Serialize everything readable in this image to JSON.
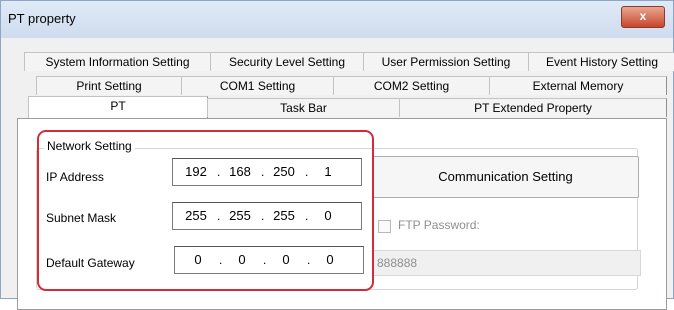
{
  "window": {
    "title": "PT property",
    "close_label": "x"
  },
  "tabs": {
    "row1": [
      "System Information Setting",
      "Security Level Setting",
      "User Permission Setting",
      "Event History Setting"
    ],
    "row2": [
      "Print Setting",
      "COM1 Setting",
      "COM2 Setting",
      "External Memory"
    ],
    "row3": [
      "PT",
      "Task Bar",
      "PT Extended Property"
    ],
    "active": "PT"
  },
  "network": {
    "group_label": "Network Setting",
    "ip_label": "IP Address",
    "ip": [
      "192",
      "168",
      "250",
      "1"
    ],
    "subnet_label": "Subnet Mask",
    "subnet": [
      "255",
      "255",
      "255",
      "0"
    ],
    "gateway_label": "Default Gateway",
    "gateway": [
      "0",
      "0",
      "0",
      "0"
    ],
    "dot": "."
  },
  "communication_button": "Communication Setting",
  "ftp": {
    "label": "FTP Password:",
    "checked": false,
    "password": "888888"
  },
  "colors": {
    "highlight": "#d12c3c",
    "titlebar": "#cfdcee",
    "close_button": "#c8452b"
  }
}
